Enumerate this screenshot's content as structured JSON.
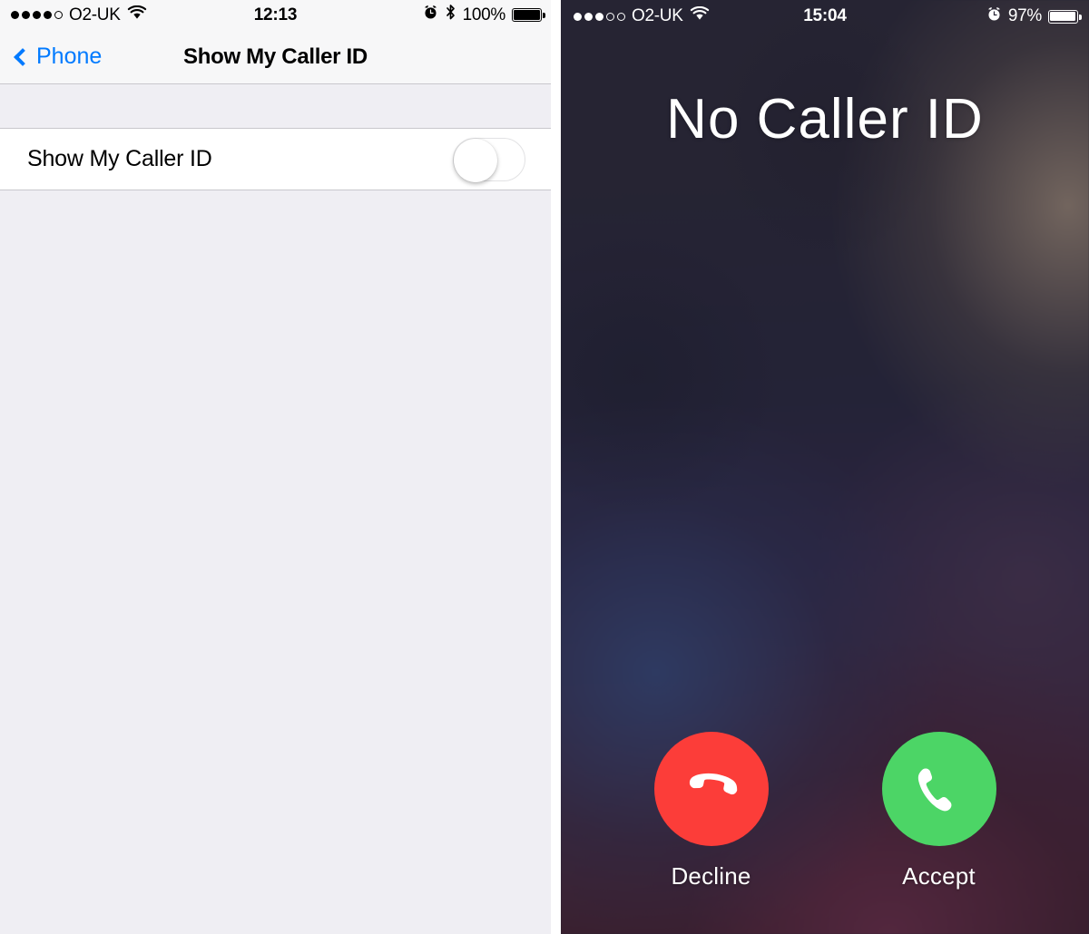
{
  "settings_screen": {
    "status_bar": {
      "signal_bars_filled": 4,
      "signal_bars_total": 5,
      "carrier": "O2-UK",
      "wifi_icon": "wifi-icon",
      "time": "12:13",
      "alarm_icon": "alarm-clock-icon",
      "bluetooth_icon": "bluetooth-icon",
      "battery_percent": "100%",
      "battery_level": 100
    },
    "nav": {
      "back_label": "Phone",
      "back_icon": "chevron-left-icon",
      "title": "Show My Caller ID"
    },
    "rows": [
      {
        "label": "Show My Caller ID",
        "control": "toggle-switch",
        "state": "off",
        "state_label": "Off"
      }
    ]
  },
  "call_screen": {
    "status_bar": {
      "signal_bars_filled": 3,
      "signal_bars_total": 5,
      "carrier": "O2-UK",
      "wifi_icon": "wifi-icon",
      "time": "15:04",
      "alarm_icon": "alarm-clock-icon",
      "battery_percent": "97%",
      "battery_level": 97
    },
    "caller_name": "No Caller ID",
    "actions": [
      {
        "label": "Decline",
        "icon": "phone-hangup-icon",
        "color": "#FC3D39"
      },
      {
        "label": "Accept",
        "icon": "phone-handset-icon",
        "color": "#4CD566"
      }
    ]
  },
  "colors": {
    "ios_blue": "#007AFF",
    "decline_red": "#FC3D39",
    "accept_green": "#4CD566",
    "settings_bg": "#EFEEF3",
    "nav_bg": "#F7F7F8",
    "separator": "#C8C7CC"
  }
}
